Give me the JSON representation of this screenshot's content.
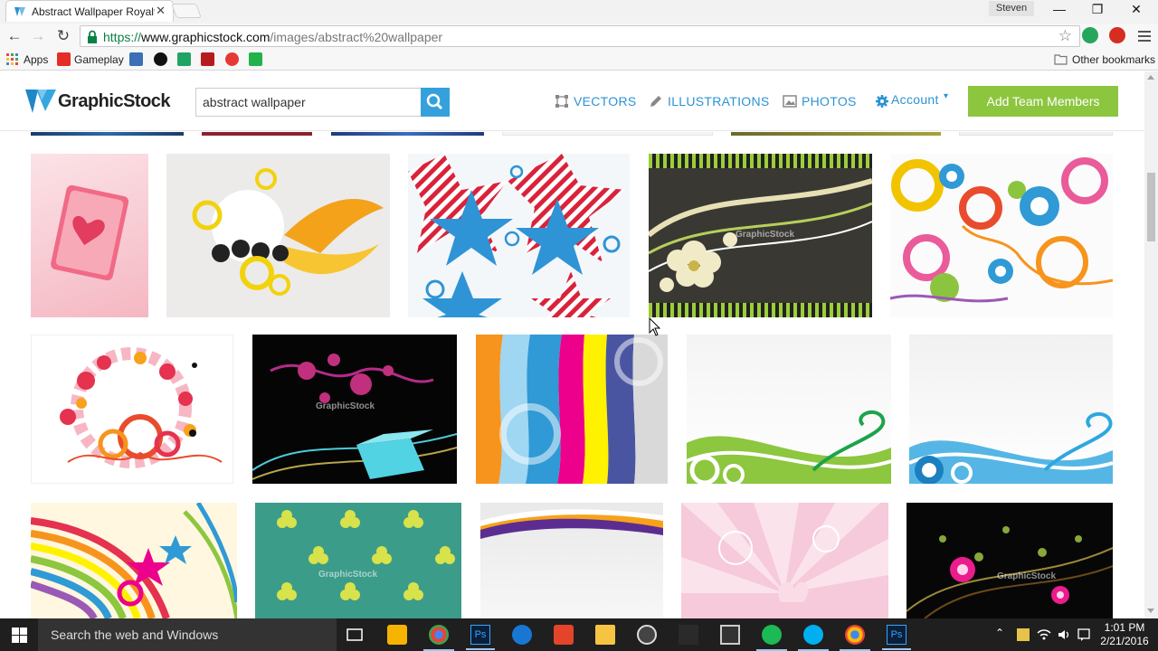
{
  "browser": {
    "tab_title": "Abstract Wallpaper Royalty",
    "user": "Steven",
    "url_scheme": "https://",
    "url_host": "www.graphicstock.com",
    "url_path": "/images/abstract%20wallpaper"
  },
  "bookmarks": {
    "apps": "Apps",
    "gameplay": "Gameplay",
    "other": "Other bookmarks"
  },
  "site": {
    "logo": "GraphicStock",
    "search_value": "abstract wallpaper",
    "nav": {
      "vectors": "VECTORS",
      "illustrations": "ILLUSTRATIONS",
      "photos": "PHOTOS",
      "account": "Account"
    },
    "add_team": "Add Team Members",
    "watermark": "GraphicStock"
  },
  "colors": {
    "accent": "#2c93d3",
    "button_green": "#8cc63f",
    "search_blue": "#34a1dc"
  },
  "taskbar": {
    "search_placeholder": "Search the web and Windows",
    "time": "1:01 PM",
    "date": "2/21/2016"
  }
}
